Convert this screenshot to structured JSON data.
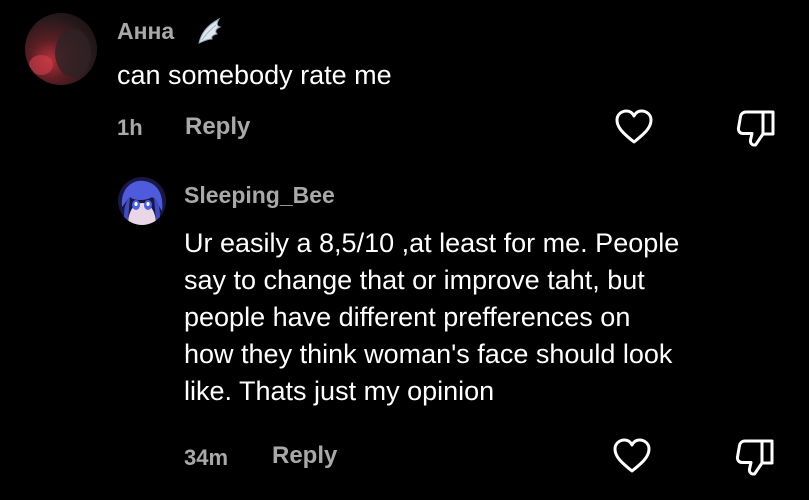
{
  "comments": [
    {
      "username": "Анна",
      "badge_icon": "angel-wing-icon",
      "text": "can somebody rate me",
      "time": "1h",
      "reply_label": "Reply",
      "avatar_icon": "user-avatar",
      "like_icon": "heart-outline-icon",
      "dislike_icon": "thumbs-down-icon"
    },
    {
      "username": "Sleeping_Bee",
      "text_lines": [
        "Ur easily a 8,5/10 ,at least for me. People",
        "say to change that or improve taht, but",
        "people have different prefferences on",
        "how they think woman's face should look",
        "like. Thats just my opinion"
      ],
      "time": "34m",
      "reply_label": "Reply",
      "avatar_icon": "anime-avatar",
      "like_icon": "heart-outline-icon",
      "dislike_icon": "thumbs-down-icon"
    }
  ],
  "colors": {
    "background": "#000000",
    "primary_text": "#ffffff",
    "secondary_text": "#a9a9a9"
  }
}
